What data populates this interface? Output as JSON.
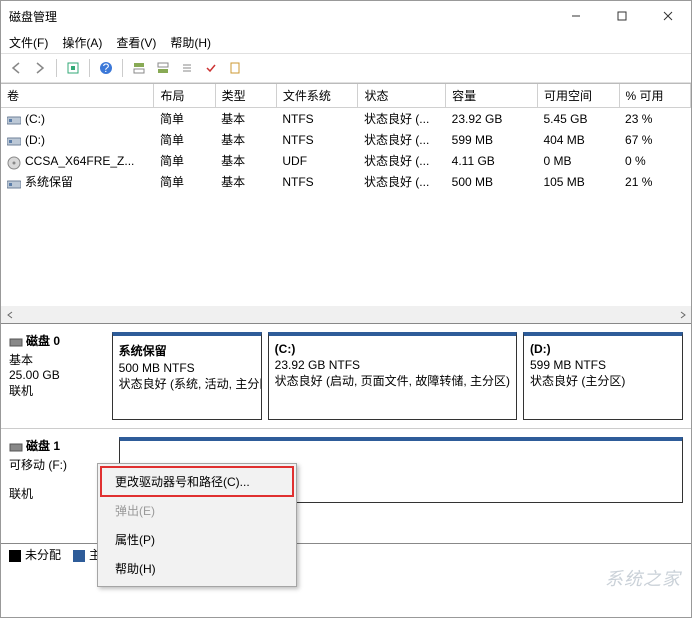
{
  "window": {
    "title": "磁盘管理"
  },
  "menu": {
    "file": "文件(F)",
    "action": "操作(A)",
    "view": "查看(V)",
    "help": "帮助(H)"
  },
  "columns": [
    "卷",
    "布局",
    "类型",
    "文件系统",
    "状态",
    "容量",
    "可用空间",
    "% 可用"
  ],
  "volumes": [
    {
      "name": "(C:)",
      "layout": "简单",
      "type": "基本",
      "fs": "NTFS",
      "status": "状态良好 (...",
      "capacity": "23.92 GB",
      "free": "5.45 GB",
      "pct": "23 %"
    },
    {
      "name": "(D:)",
      "layout": "简单",
      "type": "基本",
      "fs": "NTFS",
      "status": "状态良好 (...",
      "capacity": "599 MB",
      "free": "404 MB",
      "pct": "67 %"
    },
    {
      "name": "CCSA_X64FRE_Z...",
      "layout": "简单",
      "type": "基本",
      "fs": "UDF",
      "status": "状态良好 (...",
      "capacity": "4.11 GB",
      "free": "0 MB",
      "pct": "0 %"
    },
    {
      "name": "系统保留",
      "layout": "简单",
      "type": "基本",
      "fs": "NTFS",
      "status": "状态良好 (...",
      "capacity": "500 MB",
      "free": "105 MB",
      "pct": "21 %"
    }
  ],
  "disk0": {
    "name": "磁盘 0",
    "type": "基本",
    "size": "25.00 GB",
    "status": "联机",
    "parts": [
      {
        "name": "系统保留",
        "size": "500 MB NTFS",
        "status": "状态良好 (系统, 活动, 主分区)"
      },
      {
        "name": "(C:)",
        "size": "23.92 GB NTFS",
        "status": "状态良好 (启动, 页面文件, 故障转储, 主分区)"
      },
      {
        "name": "(D:)",
        "size": "599 MB NTFS",
        "status": "状态良好 (主分区)"
      }
    ]
  },
  "disk1": {
    "name": "磁盘 1",
    "movable": "可移动 (F:)",
    "status": "联机"
  },
  "legend": {
    "unalloc": "未分配",
    "primary": "主分区"
  },
  "ctx": {
    "change": "更改驱动器号和路径(C)...",
    "eject": "弹出(E)",
    "props": "属性(P)",
    "help": "帮助(H)"
  },
  "watermark": "系统之家"
}
